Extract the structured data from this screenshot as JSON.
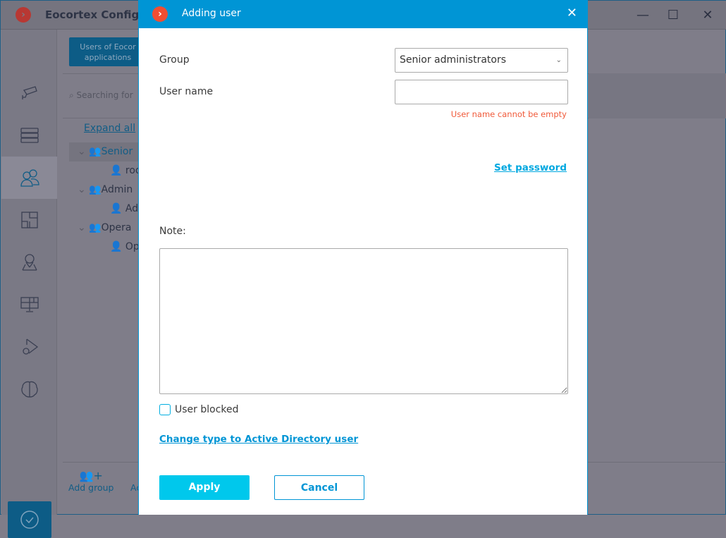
{
  "window": {
    "title": "Eocortex Configurat",
    "logo_glyph": "›",
    "controls": {
      "minimize": "—",
      "maximize": "☐",
      "close": "✕"
    }
  },
  "sidebar": {
    "items": [
      {
        "icon": "camera-icon"
      },
      {
        "icon": "server-icon"
      },
      {
        "icon": "users-icon",
        "selected": true
      },
      {
        "icon": "floor-plan-icon"
      },
      {
        "icon": "map-pin-icon"
      },
      {
        "icon": "monitor-layout-icon"
      },
      {
        "icon": "play-settings-icon"
      },
      {
        "icon": "brain-icon"
      }
    ],
    "apply_icon": "check-circle-icon"
  },
  "panel": {
    "tab_label": "Users of Eocor\napplications",
    "search_placeholder": "Searching for",
    "expand_all": "Expand all",
    "tree": [
      {
        "label": "Senior",
        "type": "group",
        "selected": true
      },
      {
        "label": "roo",
        "type": "user"
      },
      {
        "label": "Admin",
        "type": "group"
      },
      {
        "label": "Adr",
        "type": "user"
      },
      {
        "label": "Opera",
        "type": "group"
      },
      {
        "label": "Ope",
        "type": "user"
      }
    ],
    "add_group": "Add group",
    "add_next": "Ac"
  },
  "dialog": {
    "title": "Adding user",
    "logo_glyph": "›",
    "close": "✕",
    "group_label": "Group",
    "group_value": "Senior administrators",
    "username_label": "User name",
    "username_value": "",
    "username_error": "User name cannot be empty",
    "set_password": "Set password",
    "note_label": "Note:",
    "note_value": "",
    "user_blocked_label": "User blocked",
    "user_blocked": false,
    "change_type": "Change type to Active Directory user",
    "apply": "Apply",
    "cancel": "Cancel"
  },
  "colors": {
    "accent": "#0095d5",
    "apply": "#00c8ec",
    "error": "#f05a3a",
    "logo": "#f04e32"
  }
}
